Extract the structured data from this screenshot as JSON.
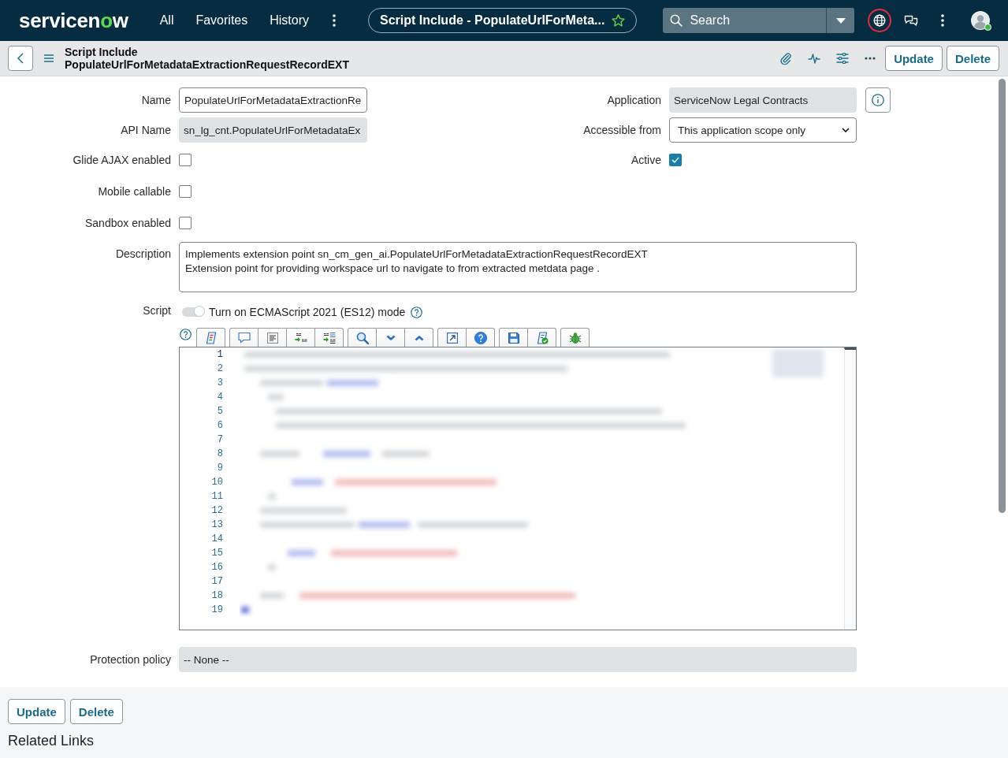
{
  "topbar": {
    "logo": [
      {
        "text": "servicen",
        "accent": false
      },
      {
        "text": "o",
        "accent": true
      },
      {
        "text": "w",
        "accent": false
      }
    ],
    "nav": [
      "All",
      "Favorites",
      "History"
    ],
    "record_pill": {
      "title": "Script Include - PopulateUrlForMeta...",
      "starred": false
    },
    "search": {
      "placeholder": "Search"
    },
    "scope_alert": true,
    "user_online": true
  },
  "record_header": {
    "type": "Script Include",
    "name": "PopulateUrlForMetadataExtractionRequestRecordEXT",
    "buttons": [
      "Update",
      "Delete"
    ]
  },
  "form": {
    "left_fields": [
      {
        "label": "Name",
        "kind": "input",
        "value": "PopulateUrlForMetadataExtractionRe"
      },
      {
        "label": "API Name",
        "kind": "readonly",
        "value": "sn_lg_cnt.PopulateUrlForMetadataEx"
      },
      {
        "label": "Glide AJAX enabled",
        "kind": "checkbox",
        "checked": false
      },
      {
        "label": "Mobile callable",
        "kind": "checkbox",
        "checked": false
      },
      {
        "label": "Sandbox enabled",
        "kind": "checkbox",
        "checked": false
      }
    ],
    "right_fields": [
      {
        "label": "Application",
        "kind": "readonly",
        "value": "ServiceNow Legal Contracts",
        "info_button": true
      },
      {
        "label": "Accessible from",
        "kind": "select",
        "value": "This application scope only"
      },
      {
        "label": "Active",
        "kind": "checkbox",
        "checked": true
      }
    ],
    "description": {
      "label": "Description",
      "value": "Implements extension point sn_cm_gen_ai.PopulateUrlForMetadataExtractionRequestRecordEXT\nExtension point for providing workspace url to navigate to from extracted metdata page ."
    },
    "script": {
      "label": "Script",
      "es12_toggle": {
        "label": "Turn on ECMAScript 2021 (ES12) mode",
        "on": true
      },
      "toolbar": [
        [
          {
            "kind": "format"
          }
        ],
        [
          {
            "kind": "comment"
          },
          {
            "kind": "outline"
          },
          {
            "kind": "replace"
          },
          {
            "kind": "replace_all"
          }
        ],
        [
          {
            "kind": "search"
          },
          {
            "kind": "next"
          },
          {
            "kind": "previous"
          }
        ],
        [
          {
            "kind": "fullscreen"
          },
          {
            "kind": "help"
          }
        ],
        [
          {
            "kind": "save"
          },
          {
            "kind": "validate"
          }
        ],
        [
          {
            "kind": "debug"
          }
        ]
      ],
      "lines": [
        {
          "number": "1",
          "current": true
        },
        {
          "number": "2",
          "current": false
        },
        {
          "number": "3",
          "current": false
        },
        {
          "number": "4",
          "current": false
        },
        {
          "number": "5",
          "current": false
        },
        {
          "number": "6",
          "current": false
        },
        {
          "number": "7",
          "current": false
        },
        {
          "number": "8",
          "current": false
        },
        {
          "number": "9",
          "current": false
        },
        {
          "number": "10",
          "current": false
        },
        {
          "number": "11",
          "current": false
        },
        {
          "number": "12",
          "current": false
        },
        {
          "number": "13",
          "current": false
        },
        {
          "number": "14",
          "current": false
        },
        {
          "number": "15",
          "current": false
        },
        {
          "number": "16",
          "current": false
        },
        {
          "number": "17",
          "current": false
        },
        {
          "number": "18",
          "current": false
        },
        {
          "number": "19",
          "current": false
        }
      ]
    },
    "protection_policy": {
      "label": "Protection policy",
      "value": "-- None --"
    }
  },
  "footer": {
    "buttons": [
      "Update",
      "Delete"
    ],
    "related_links_title": "Related Links"
  }
}
